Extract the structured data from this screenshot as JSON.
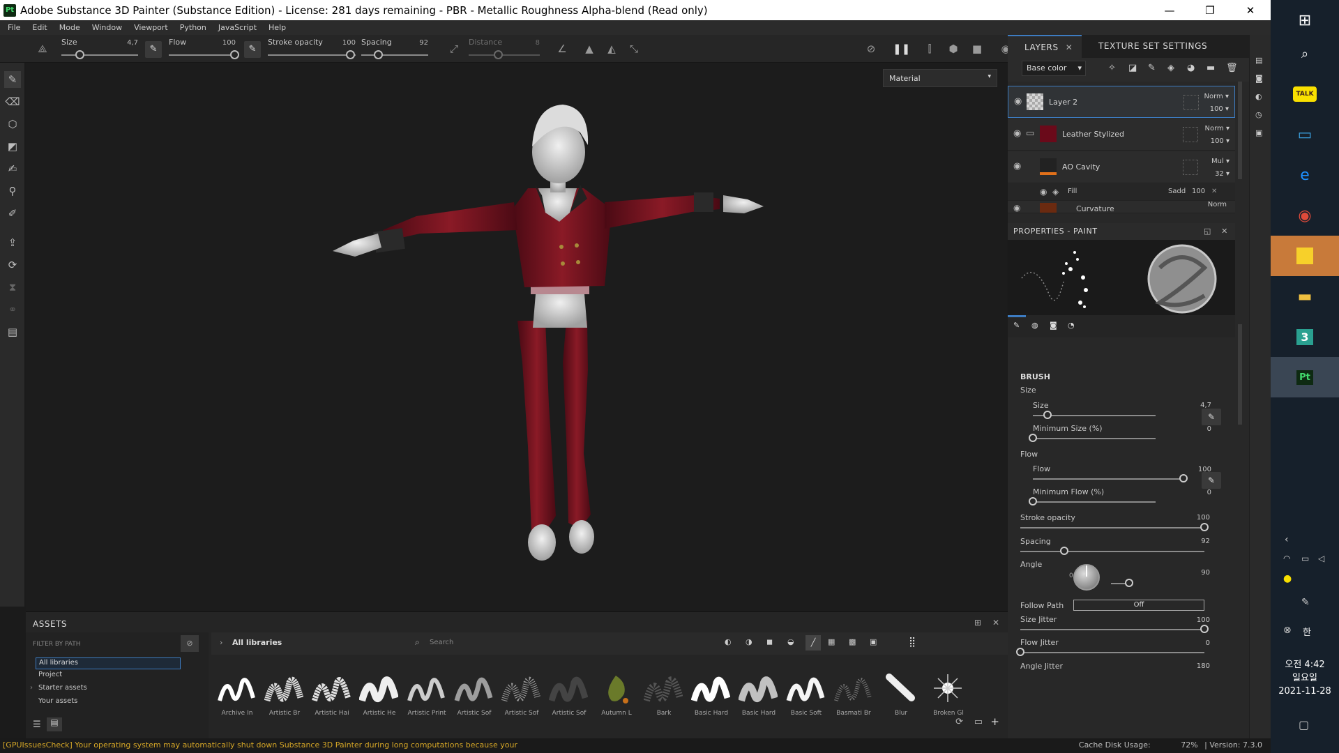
{
  "window": {
    "title": "Adobe Substance 3D Painter (Substance Edition) - License: 281 days remaining - PBR - Metallic Roughness Alpha-blend (Read only)",
    "logo": "Pt"
  },
  "menu": [
    "File",
    "Edit",
    "Mode",
    "Window",
    "Viewport",
    "Python",
    "JavaScript",
    "Help"
  ],
  "toolbar": {
    "size": {
      "label": "Size",
      "value": "4,7"
    },
    "flow": {
      "label": "Flow",
      "value": "100"
    },
    "stroke_opacity": {
      "label": "Stroke opacity",
      "value": "100"
    },
    "spacing": {
      "label": "Spacing",
      "value": "92"
    },
    "distance": {
      "label": "Distance",
      "value": "8"
    }
  },
  "viewport": {
    "material_mode": "Material"
  },
  "right_tabs": {
    "layers": "LAYERS",
    "texture_set": "TEXTURE SET SETTINGS"
  },
  "channel_select": "Base color",
  "layers": [
    {
      "name": "Layer 2",
      "blend": "Norm",
      "opacity": "100",
      "swatch": "#d8d8d8"
    },
    {
      "name": "Leather Stylized",
      "blend": "Norm",
      "opacity": "100",
      "swatch": "#6a0a1a"
    },
    {
      "name": "AO Cavity",
      "blend": "Mul",
      "opacity": "32",
      "swatch": "#222222"
    }
  ],
  "fill_effect": {
    "name": "Fill",
    "blend": "Sadd",
    "opacity": "100"
  },
  "partial_layer": {
    "name": "Curvature",
    "blend": "Norm"
  },
  "properties": {
    "title": "PROPERTIES - PAINT",
    "brush_header": "BRUSH",
    "size_group": "Size",
    "size": {
      "label": "Size",
      "value": "4,7",
      "fraction": 0.12
    },
    "min_size": {
      "label": "Minimum Size (%)",
      "value": "0",
      "fraction": 0
    },
    "flow_group": "Flow",
    "flow": {
      "label": "Flow",
      "value": "100",
      "fraction": 1
    },
    "min_flow": {
      "label": "Minimum Flow (%)",
      "value": "0",
      "fraction": 0
    },
    "stroke_opacity": {
      "label": "Stroke opacity",
      "value": "100",
      "fraction": 1
    },
    "spacing": {
      "label": "Spacing",
      "value": "92",
      "fraction": 0.24
    },
    "angle": {
      "label": "Angle",
      "value": "90",
      "dial_zero": "0"
    },
    "follow_path": {
      "label": "Follow Path",
      "value": "Off"
    },
    "size_jitter": {
      "label": "Size Jitter",
      "value": "100",
      "fraction": 1
    },
    "flow_jitter": {
      "label": "Flow Jitter",
      "value": "0",
      "fraction": 0
    },
    "angle_jitter": {
      "label": "Angle Jitter",
      "value": "180"
    }
  },
  "assets": {
    "title": "ASSETS",
    "filter_placeholder": "FILTER BY PATH",
    "tree": [
      "All libraries",
      "Project",
      "Starter assets",
      "Your assets"
    ],
    "breadcrumb": "All libraries",
    "search_placeholder": "Search",
    "items": [
      "Archive In",
      "Artistic Br",
      "Artistic Hai",
      "Artistic He",
      "Artistic Print",
      "Artistic Sof",
      "Artistic Sof",
      "Artistic Sof",
      "Autumn L",
      "Bark",
      "Basic Hard",
      "Basic Hard",
      "Basic Soft",
      "Basmati Br",
      "Blur",
      "Broken Gl"
    ]
  },
  "status": {
    "warning": "[GPUIssuesCheck] Your operating system may automatically shut down Substance 3D Painter during long computations because your",
    "cache": "Cache Disk Usage:",
    "cache_value": "72%",
    "version": "| Version: 7.3.0"
  },
  "taskbar": {
    "time": "오전 4:42",
    "day": "일요일",
    "date": "2021-11-28",
    "ime": "한"
  }
}
